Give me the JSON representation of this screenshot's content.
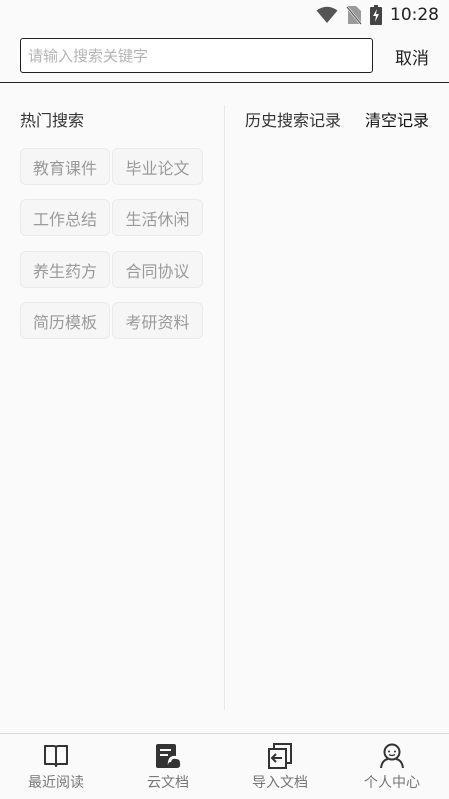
{
  "status_bar": {
    "time": "10:28"
  },
  "search": {
    "placeholder": "请输入搜索关键字",
    "value": "",
    "cancel_label": "取消"
  },
  "hot_search": {
    "title": "热门搜索",
    "tags": [
      "教育课件",
      "毕业论文",
      "工作总结",
      "生活休闲",
      "养生药方",
      "合同协议",
      "简历模板",
      "考研资料"
    ]
  },
  "history": {
    "title": "历史搜索记录",
    "clear_label": "清空记录",
    "items": []
  },
  "bottom_nav": {
    "items": [
      {
        "label": "最近阅读",
        "icon": "book-icon"
      },
      {
        "label": "云文档",
        "icon": "cloud-document-icon"
      },
      {
        "label": "导入文档",
        "icon": "import-icon"
      },
      {
        "label": "个人中心",
        "icon": "user-icon"
      }
    ]
  }
}
